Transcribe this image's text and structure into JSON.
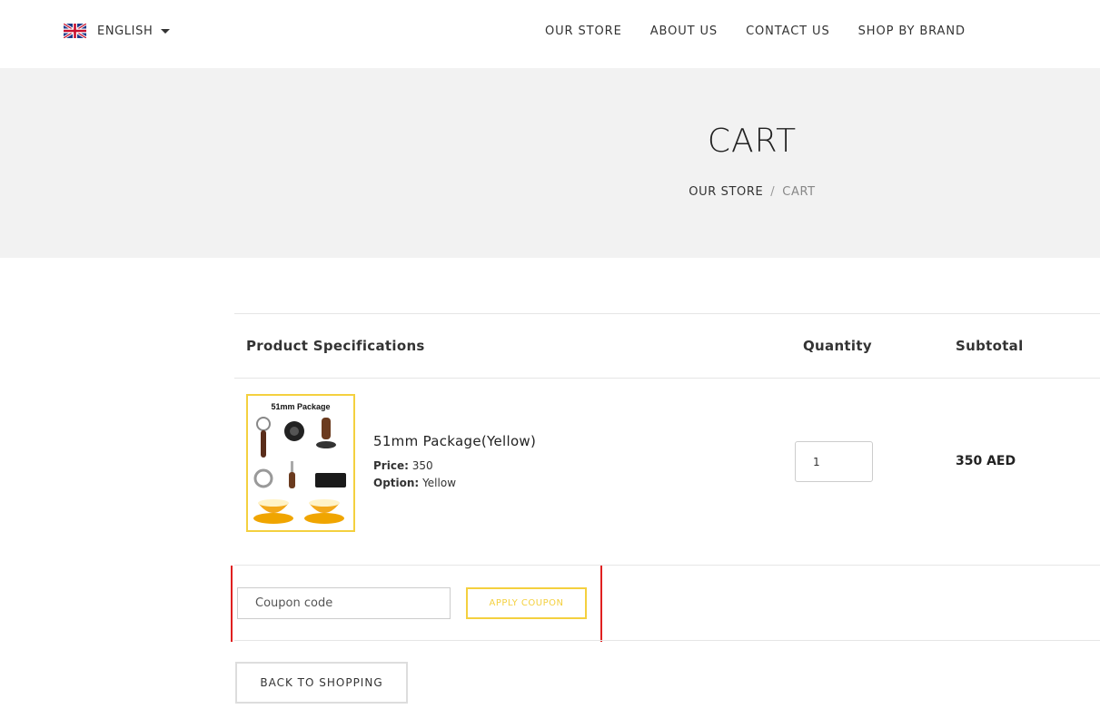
{
  "language": {
    "label": "ENGLISH",
    "flag_icon": "uk-flag-icon"
  },
  "nav": [
    {
      "label": "OUR STORE"
    },
    {
      "label": "ABOUT US"
    },
    {
      "label": "CONTACT US"
    },
    {
      "label": "SHOP BY BRAND"
    }
  ],
  "hero": {
    "title": "CART",
    "breadcrumb": {
      "home": "OUR STORE",
      "separator": "/",
      "current": "CART"
    }
  },
  "cart": {
    "headers": {
      "product": "Product Specifications",
      "quantity": "Quantity",
      "subtotal": "Subtotal"
    },
    "items": [
      {
        "image_title": "51mm Package",
        "name": "51mm Package(Yellow)",
        "price_label": "Price:",
        "price": "350",
        "option_label": "Option:",
        "option": "Yellow",
        "quantity": "1",
        "subtotal": "350 AED"
      }
    ]
  },
  "coupon": {
    "placeholder": "Coupon code",
    "apply_label": "APPLY COUPON"
  },
  "back_label": "BACK TO SHOPPING",
  "colors": {
    "accent": "#f4d03f",
    "hero_bg": "#f2f2f2",
    "outline_red": "#e02020"
  }
}
